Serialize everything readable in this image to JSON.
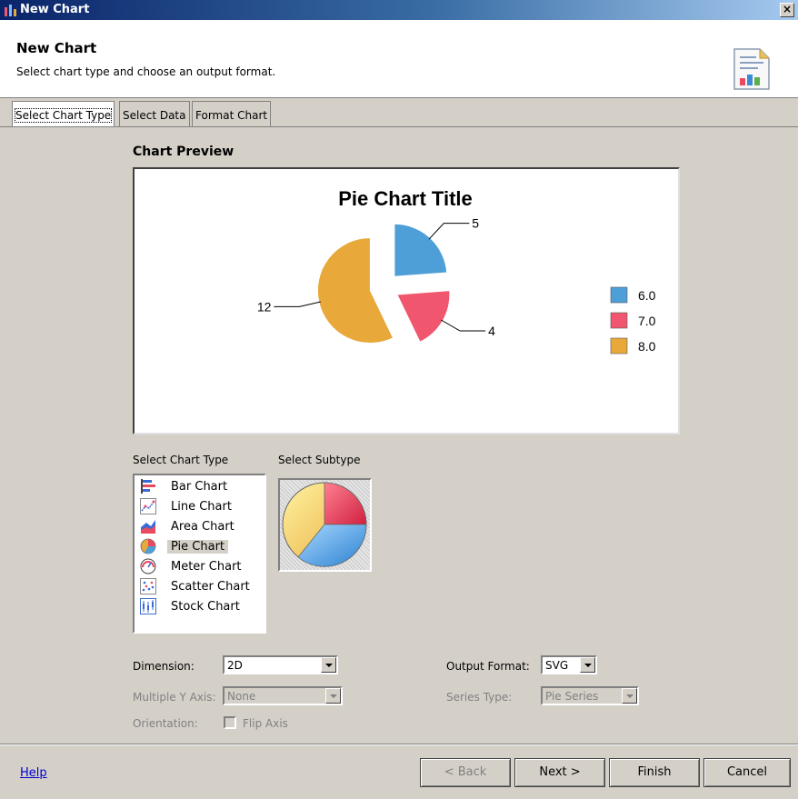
{
  "window": {
    "title": "New Chart",
    "close_glyph": "×"
  },
  "header": {
    "title": "New Chart",
    "description": "Select chart type and choose an output format.",
    "icon": "chart-document-icon"
  },
  "tabs": [
    {
      "label": "Select Chart Type",
      "active": true
    },
    {
      "label": "Select Data",
      "active": false
    },
    {
      "label": "Format Chart",
      "active": false
    }
  ],
  "preview": {
    "label": "Chart Preview",
    "chart_data": {
      "type": "pie",
      "title": "Pie Chart Title",
      "labels": [
        "6.0",
        "7.0",
        "8.0"
      ],
      "values": [
        5,
        4,
        12
      ],
      "data_labels": [
        "5",
        "4",
        "12"
      ],
      "colors": [
        "#4e9fd8",
        "#f0566e",
        "#e8a93a"
      ],
      "exploded": true,
      "legend_position": "right"
    }
  },
  "chart_type": {
    "label": "Select Chart Type",
    "items": [
      {
        "label": "Bar Chart",
        "icon": "bar-chart-icon",
        "selected": false
      },
      {
        "label": "Line Chart",
        "icon": "line-chart-icon",
        "selected": false
      },
      {
        "label": "Area Chart",
        "icon": "area-chart-icon",
        "selected": false
      },
      {
        "label": "Pie Chart",
        "icon": "pie-chart-icon",
        "selected": true
      },
      {
        "label": "Meter Chart",
        "icon": "meter-chart-icon",
        "selected": false
      },
      {
        "label": "Scatter Chart",
        "icon": "scatter-chart-icon",
        "selected": false
      },
      {
        "label": "Stock Chart",
        "icon": "stock-chart-icon",
        "selected": false
      }
    ]
  },
  "subtype": {
    "label": "Select Subtype",
    "icon": "pie-subtype-icon"
  },
  "form": {
    "dimension_label": "Dimension:",
    "dimension_value": "2D",
    "multiple_y_label": "Multiple Y Axis:",
    "multiple_y_value": "None",
    "orientation_label": "Orientation:",
    "flip_axis_label": "Flip Axis",
    "flip_axis_checked": false,
    "output_format_label": "Output Format:",
    "output_format_value": "SVG",
    "series_type_label": "Series Type:",
    "series_type_value": "Pie Series"
  },
  "footer": {
    "help": "Help",
    "back": "< Back",
    "next": "Next >",
    "finish": "Finish",
    "cancel": "Cancel"
  }
}
